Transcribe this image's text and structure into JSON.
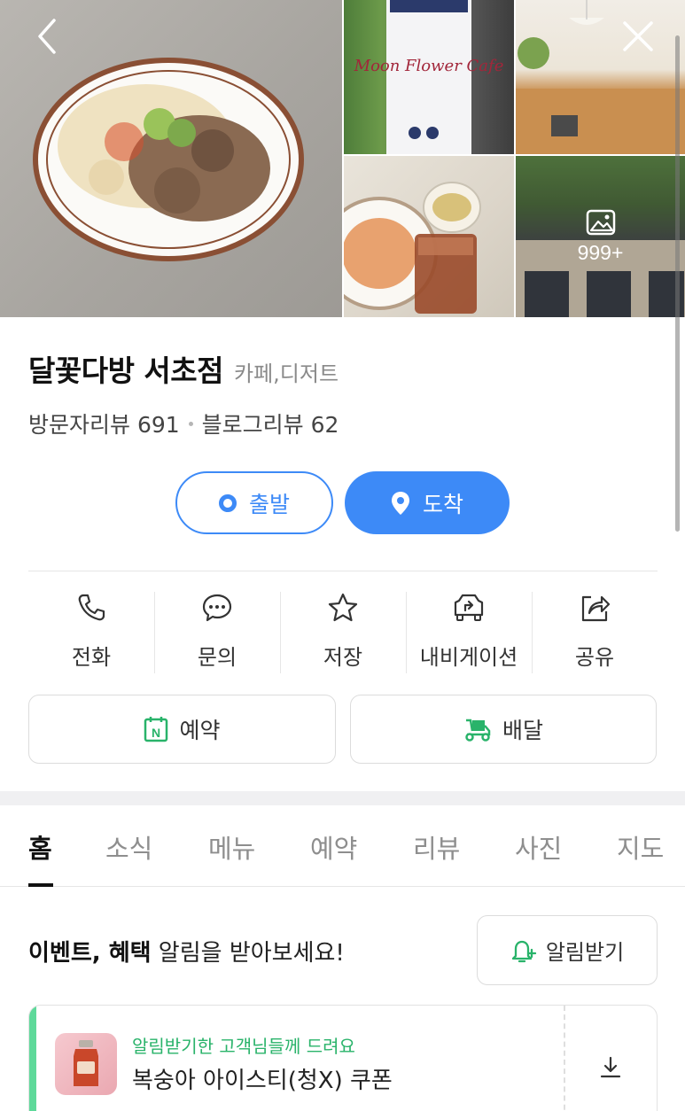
{
  "photos": {
    "sign_text": "Moon Flower Cafe",
    "more_count": "999+"
  },
  "place": {
    "name": "달꽃다방 서초점",
    "category": "카페,디저트",
    "visitor_reviews": "방문자리뷰 691",
    "blog_reviews": "블로그리뷰 62"
  },
  "route": {
    "start_label": "출발",
    "end_label": "도착"
  },
  "actions": [
    {
      "label": "전화",
      "icon": "phone-icon"
    },
    {
      "label": "문의",
      "icon": "chat-icon"
    },
    {
      "label": "저장",
      "icon": "star-icon"
    },
    {
      "label": "내비게이션",
      "icon": "navigation-icon"
    },
    {
      "label": "공유",
      "icon": "share-icon"
    }
  ],
  "booking": {
    "reserve_label": "예약",
    "delivery_label": "배달"
  },
  "tabs": [
    "홈",
    "소식",
    "메뉴",
    "예약",
    "리뷰",
    "사진",
    "지도"
  ],
  "alert": {
    "text_bold": "이벤트, 혜택",
    "text_rest": " 알림을 받아보세요!",
    "button_label": "알림받기"
  },
  "coupon": {
    "eyebrow": "알림받기한 고객님들께 드려요",
    "title": "복숭아 아이스티(청X) 쿠폰"
  },
  "colors": {
    "primary": "#3d8af7",
    "naver_green": "#29b36a",
    "coupon_accent": "#5ed99a"
  }
}
